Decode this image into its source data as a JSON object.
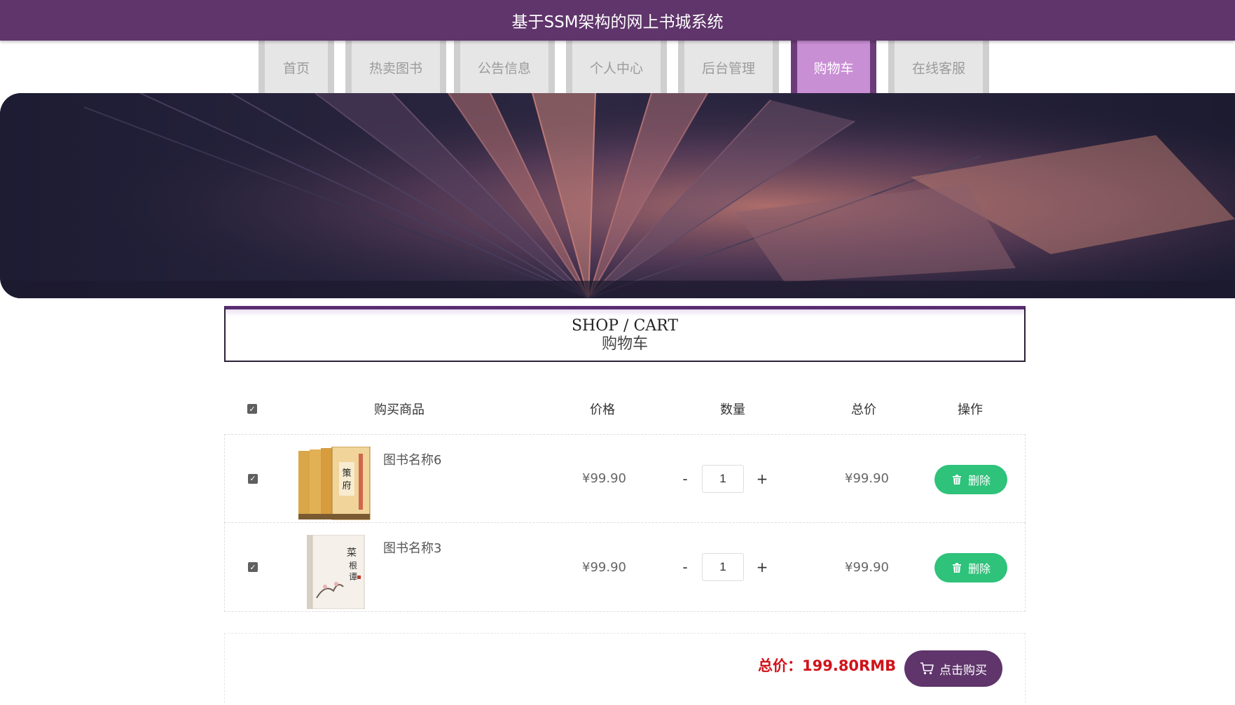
{
  "app": {
    "title": "基于SSM架构的网上书城系统"
  },
  "nav": {
    "items": [
      {
        "label": "首页"
      },
      {
        "label": "热卖图书"
      },
      {
        "label": "公告信息"
      },
      {
        "label": "个人中心"
      },
      {
        "label": "后台管理"
      },
      {
        "label": "购物车",
        "active": true
      },
      {
        "label": "在线客服"
      }
    ]
  },
  "section": {
    "title_en": "SHOP / CART",
    "title_cn": "购物车"
  },
  "cart": {
    "headers": {
      "product": "购买商品",
      "price": "价格",
      "quantity": "数量",
      "subtotal": "总价",
      "action": "操作"
    },
    "select_all_checked": true,
    "qty_minus": "-",
    "qty_plus": "+",
    "delete_label": "删除",
    "items": [
      {
        "name": "图书名称6",
        "price": "¥99.90",
        "quantity": "1",
        "subtotal": "¥99.90",
        "checked": true
      },
      {
        "name": "图书名称3",
        "price": "¥99.90",
        "quantity": "1",
        "subtotal": "¥99.90",
        "checked": true
      }
    ]
  },
  "total": {
    "label": "总价：199.80RMB",
    "buy_label": "点击购买"
  },
  "colors": {
    "brand": "#5f356b",
    "nav_active": "#c98fd4",
    "delete_button": "#2ec27a",
    "total_text": "#d0131a"
  },
  "icons": [
    "checkbox-icon",
    "trash-icon",
    "cart-icon"
  ]
}
